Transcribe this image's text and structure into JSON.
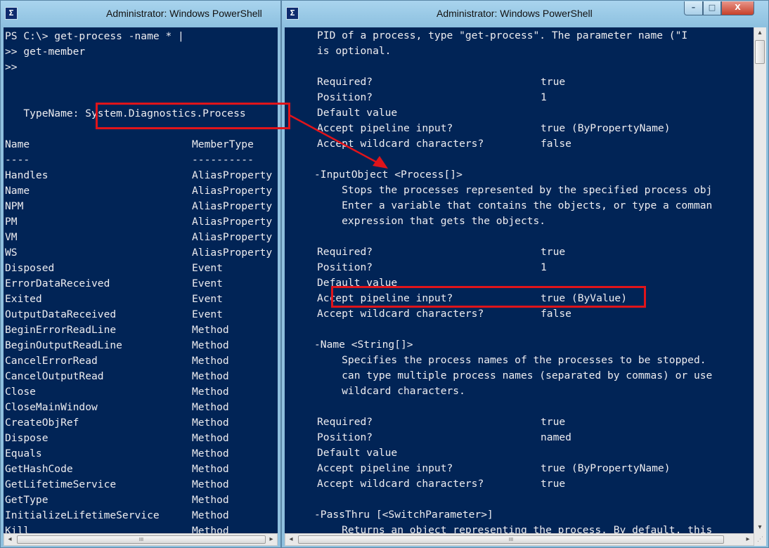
{
  "left_window": {
    "title": "Administrator: Windows PowerShell",
    "icon_glyph": "Σ",
    "lines": [
      "PS C:\\> get-process -name * |",
      ">> get-member",
      ">>",
      "",
      "",
      "   TypeName: System.Diagnostics.Process",
      "",
      "Name",
      "----",
      "Handles",
      "Name",
      "NPM",
      "PM",
      "VM",
      "WS",
      "Disposed",
      "ErrorDataReceived",
      "Exited",
      "OutputDataReceived",
      "BeginErrorReadLine",
      "BeginOutputReadLine",
      "CancelErrorRead",
      "CancelOutputRead",
      "Close",
      "CloseMainWindow",
      "CreateObjRef",
      "Dispose",
      "Equals",
      "GetHashCode",
      "GetLifetimeService",
      "GetType",
      "InitializeLifetimeService",
      "Kill"
    ],
    "member_types": [
      "MemberType",
      "----------",
      "AliasProperty",
      "AliasProperty",
      "AliasProperty",
      "AliasProperty",
      "AliasProperty",
      "AliasProperty",
      "Event",
      "Event",
      "Event",
      "Event",
      "Method",
      "Method",
      "Method",
      "Method",
      "Method",
      "Method",
      "Method",
      "Method",
      "Method",
      "Method",
      "Method",
      "Method",
      "Method",
      "Method"
    ],
    "hscroll_grip": "III"
  },
  "right_window": {
    "title": "Administrator: Windows PowerShell",
    "icon_glyph": "Σ",
    "controls": {
      "minimize": "–",
      "maximize": "□",
      "close": "X"
    },
    "lines": [
      {
        "text": "PID of a process, type \"get-process\". The parameter name (\"I",
        "value": ""
      },
      {
        "text": "is optional.",
        "value": ""
      },
      {
        "text": "",
        "value": ""
      },
      {
        "text": "Required?",
        "value": "true"
      },
      {
        "text": "Position?",
        "value": "1"
      },
      {
        "text": "Default value",
        "value": ""
      },
      {
        "text": "Accept pipeline input?",
        "value": "true (ByPropertyName)"
      },
      {
        "text": "Accept wildcard characters?",
        "value": "false"
      },
      {
        "text": "",
        "value": ""
      },
      {
        "text": "-InputObject <Process[]>",
        "value": ""
      },
      {
        "text": "    Stops the processes represented by the specified process obj",
        "value": ""
      },
      {
        "text": "    Enter a variable that contains the objects, or type a comman",
        "value": ""
      },
      {
        "text": "    expression that gets the objects.",
        "value": ""
      },
      {
        "text": "",
        "value": ""
      },
      {
        "text": "Required?",
        "value": "true"
      },
      {
        "text": "Position?",
        "value": "1"
      },
      {
        "text": "Default value",
        "value": ""
      },
      {
        "text": "Accept pipeline input?",
        "value": "true (ByValue)"
      },
      {
        "text": "Accept wildcard characters?",
        "value": "false"
      },
      {
        "text": "",
        "value": ""
      },
      {
        "text": "-Name <String[]>",
        "value": ""
      },
      {
        "text": "    Specifies the process names of the processes to be stopped.",
        "value": ""
      },
      {
        "text": "    can type multiple process names (separated by commas) or use",
        "value": ""
      },
      {
        "text": "    wildcard characters.",
        "value": ""
      },
      {
        "text": "",
        "value": ""
      },
      {
        "text": "Required?",
        "value": "true"
      },
      {
        "text": "Position?",
        "value": "named"
      },
      {
        "text": "Default value",
        "value": ""
      },
      {
        "text": "Accept pipeline input?",
        "value": "true (ByPropertyName)"
      },
      {
        "text": "Accept wildcard characters?",
        "value": "true"
      },
      {
        "text": "",
        "value": ""
      },
      {
        "text": "-PassThru [<SwitchParameter>]",
        "value": ""
      },
      {
        "text": "    Returns an object representing the process. By default, this",
        "value": ""
      }
    ],
    "hscroll_grip": "III"
  },
  "colors": {
    "console_bg": "#012456",
    "console_text": "#eeedf0",
    "highlight": "#e0141a",
    "titlebar": "#8fc0de"
  }
}
